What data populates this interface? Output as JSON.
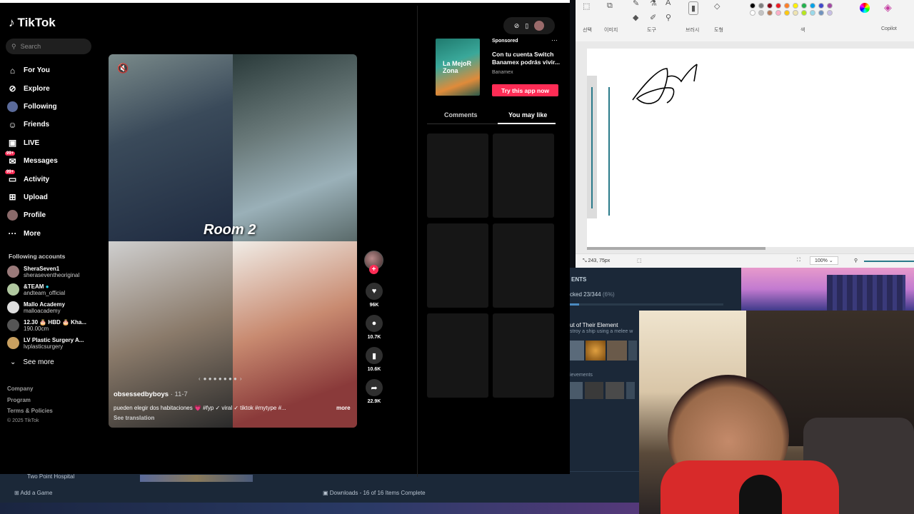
{
  "tiktok": {
    "logo": "TikTok",
    "search_placeholder": "Search",
    "nav": [
      {
        "label": "For You",
        "icon": "home-icon"
      },
      {
        "label": "Explore",
        "icon": "compass-icon"
      },
      {
        "label": "Following",
        "icon": "following-icon"
      },
      {
        "label": "Friends",
        "icon": "friends-icon"
      },
      {
        "label": "LIVE",
        "icon": "live-icon"
      },
      {
        "label": "Messages",
        "icon": "messages-icon",
        "badge": "99+"
      },
      {
        "label": "Activity",
        "icon": "activity-icon",
        "badge": "99+"
      },
      {
        "label": "Upload",
        "icon": "upload-icon"
      },
      {
        "label": "Profile",
        "icon": "profile-icon"
      },
      {
        "label": "More",
        "icon": "more-icon"
      }
    ],
    "following_title": "Following accounts",
    "accounts": [
      {
        "name": "SheraSeven1",
        "handle": "sheraseventheoriginal"
      },
      {
        "name": "&TEAM",
        "handle": "andteam_official"
      },
      {
        "name": "Mallo Academy",
        "handle": "malloacademy"
      },
      {
        "name": "12.30 🎂 HBD 🎂 Kha...",
        "handle": "190.00cm"
      },
      {
        "name": "LV Plastic Surgery A...",
        "handle": "lvplasticsurgery"
      }
    ],
    "see_more": "See more",
    "footer": [
      "Company",
      "Program",
      "Terms & Policies"
    ],
    "copyright": "© 2025 TikTok",
    "video": {
      "overlay_text": "Room 2",
      "author": "obsessedbyboys",
      "date": " · 11-7",
      "caption": "pueden elegir dos habitaciones 💗 #fyp ✓ viral ✓ tiktok #mytype #...",
      "more": "more",
      "translation": "See translation"
    },
    "actions": [
      {
        "icon": "heart-icon",
        "count": "96K"
      },
      {
        "icon": "comment-icon",
        "count": "10.7K"
      },
      {
        "icon": "bookmark-icon",
        "count": "10.6K"
      },
      {
        "icon": "share-icon",
        "count": "22.9K"
      }
    ],
    "ad": {
      "sponsored": "Sponsored",
      "image_text": "La MejoR Zona",
      "title": "Con tu cuenta Switch Banamex podrás vivir...",
      "brand": "Banamex",
      "cta": "Try this app now"
    },
    "tabs": [
      "Comments",
      "You may like"
    ]
  },
  "paint": {
    "labels": [
      "선택",
      "이미지",
      "도구",
      "브러시",
      "도형",
      "색",
      "Copilot"
    ],
    "status_coords": "243, 75px",
    "zoom": "100%",
    "swatches": [
      "#000000",
      "#7f7f7f",
      "#880015",
      "#ed1c24",
      "#ff7f27",
      "#fff200",
      "#22b14c",
      "#00a2e8",
      "#3f48cc",
      "#a349a4",
      "#ffffff",
      "#c3c3c3",
      "#b97a57",
      "#ffaec9",
      "#ffc90e",
      "#efe4b0",
      "#b5e61d",
      "#99d9ea",
      "#7092be",
      "#c8bfe7"
    ]
  },
  "game": {
    "header": "ENTS",
    "progress": "cked 23/344",
    "progress_pct": "(6%)",
    "achievement_title": "ut of Their Element",
    "achievement_desc": "stroy a ship using a melee w",
    "section": "ievements"
  },
  "steam": {
    "game_label": "Two Point Hospital",
    "add_game": "Add a Game",
    "downloads": "Downloads - 16 of 16 Items Complete"
  }
}
